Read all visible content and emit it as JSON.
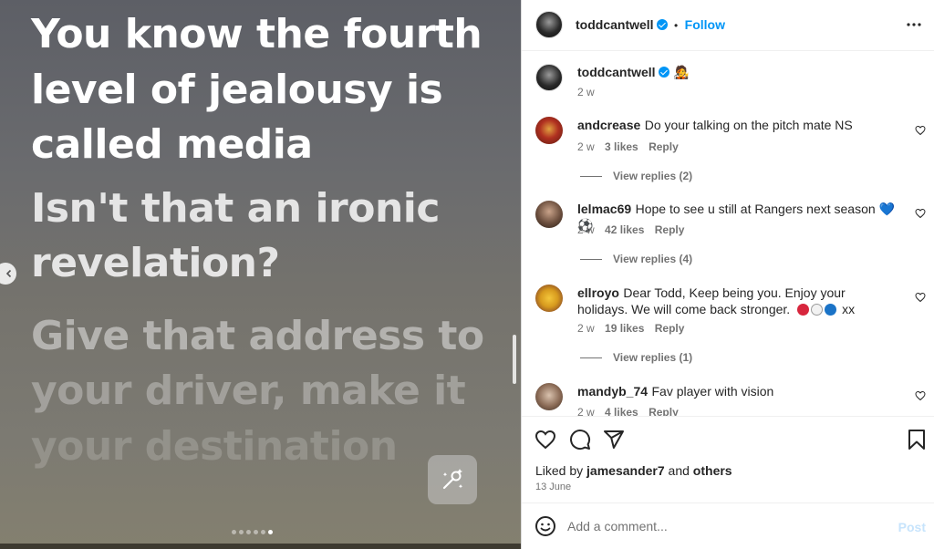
{
  "media": {
    "lyric_1": "You know the fourth level of jealousy is called media",
    "lyric_2": "Isn't that an ironic revelation?",
    "lyric_3a": "Give that address to",
    "lyric_3b": "your driver, make it",
    "lyric_3c": "your destination",
    "slide_count": 6,
    "active_slide": 6
  },
  "post": {
    "author": "toddcantwell",
    "follow_label": "Follow",
    "separator": "•",
    "caption_time": "2 w",
    "caption_emoji": "🧑‍🎤"
  },
  "comments": [
    {
      "user": "andcrease",
      "text": "Do your talking on the pitch mate NS",
      "time": "2 w",
      "likes": "3 likes",
      "reply": "Reply",
      "view_replies": "View replies (2)"
    },
    {
      "user": "lelmac69",
      "text": "Hope to see u still at Rangers next season 💙⚽",
      "time": "2 w",
      "likes": "42 likes",
      "reply": "Reply",
      "view_replies": "View replies (4)"
    },
    {
      "user": "ellroyo",
      "text": "Dear Todd, Keep being you. Enjoy your holidays. We will come back stronger.",
      "text_tail": "xx",
      "time": "2 w",
      "likes": "19 likes",
      "reply": "Reply",
      "view_replies": "View replies (1)"
    },
    {
      "user": "mandyb_74",
      "text": "Fav player with vision",
      "time": "2 w",
      "likes": "4 likes",
      "reply": "Reply"
    }
  ],
  "likes_line": {
    "prefix": "Liked by",
    "user": "jamesander7",
    "middle": "and",
    "others": "others"
  },
  "post_date": "13 June",
  "comment_input": {
    "placeholder": "Add a comment...",
    "post_label": "Post"
  },
  "colors": {
    "accent": "#0095f6",
    "text": "#262626",
    "muted": "#737373",
    "post_disabled": "#c7e4fc"
  }
}
